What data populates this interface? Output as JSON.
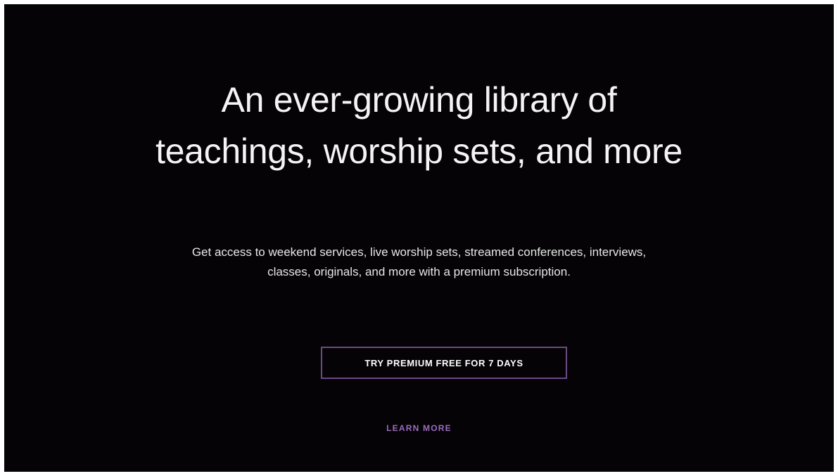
{
  "hero": {
    "headline": "An ever-growing library of teachings, worship sets, and more",
    "subtext": "Get access to weekend services, live worship sets, streamed conferences, interviews, classes, originals, and more with a premium subscription.",
    "cta_label": "TRY PREMIUM FREE FOR 7 DAYS",
    "learn_more_label": "LEARN MORE"
  },
  "colors": {
    "background": "#050305",
    "text": "#f4f4f4",
    "button_border": "#6b4a86",
    "link_accent": "#9a6cc0"
  }
}
